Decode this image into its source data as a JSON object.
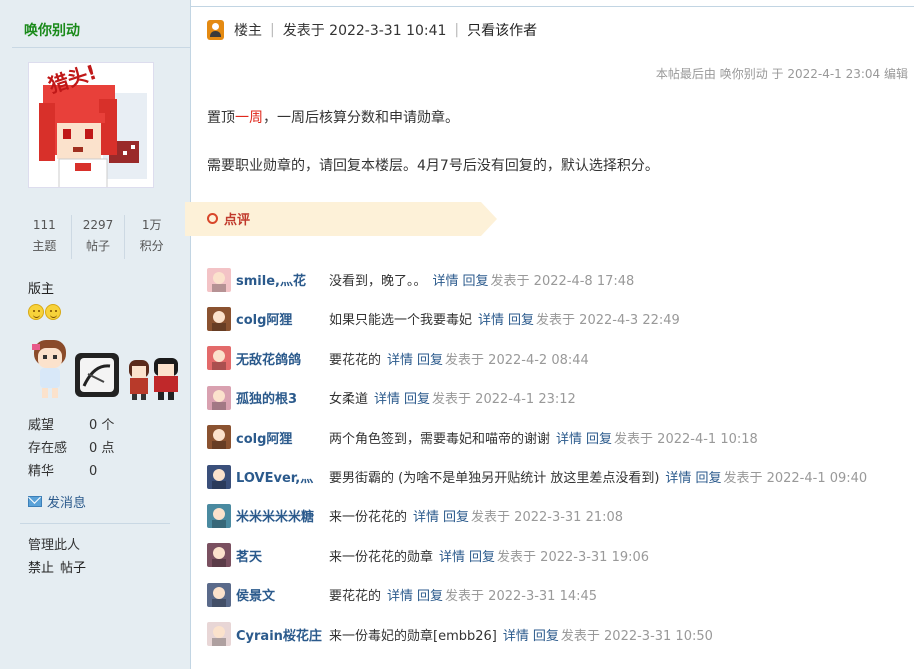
{
  "sidebar": {
    "username": "唤你别动",
    "stats": [
      {
        "num": "111",
        "label": "主题"
      },
      {
        "num": "2297",
        "label": "帖子"
      },
      {
        "num": "1万",
        "label": "积分"
      }
    ],
    "group": "版主",
    "info": [
      {
        "k": "威望",
        "v": "0 个"
      },
      {
        "k": "存在感",
        "v": "0 点"
      },
      {
        "k": "精华",
        "v": "0"
      }
    ],
    "send_message": "发消息",
    "manage_title": "管理此人",
    "manage_ban": "禁止",
    "manage_posts": "帖子",
    "avatar_stamp": "猎头!"
  },
  "post": {
    "floor": "楼主",
    "posted_at": "发表于 2022-3-31 10:41",
    "author_only": "只看该作者",
    "edited_note": "本帖最后由 唤你别动 于 2022-4-1 23:04 编辑",
    "line1_pre": "置顶",
    "line1_red": "一周",
    "line1_post": "，一周后核算分数和申请勋章。",
    "line2": "需要职业勋章的，请回复本楼层。4月7号后没有回复的，默认选择积分。"
  },
  "dianping": {
    "label": "点评"
  },
  "comment_links": {
    "detail": "详情",
    "reply": "回复"
  },
  "comments": [
    {
      "name": "smile,灬花",
      "text": "没看到，晚了。。",
      "time": "发表于 2022-4-8 17:48",
      "color": "#f3c3c6"
    },
    {
      "name": "colg阿狸",
      "text": "如果只能选一个我要毒妃",
      "time": "发表于 2022-4-3 22:49",
      "color": "#8a5230"
    },
    {
      "name": "无敌花鸽鸽",
      "text": "要花花的",
      "time": "发表于 2022-4-2 08:44",
      "color": "#e36a6a"
    },
    {
      "name": "孤独的根3",
      "text": "女柔道",
      "time": "发表于 2022-4-1 23:12",
      "color": "#d9a1b0"
    },
    {
      "name": "colg阿狸",
      "text": "两个角色签到，需要毒妃和喵帝的谢谢",
      "time": "发表于 2022-4-1 10:18",
      "color": "#8a5230"
    },
    {
      "name": "LOVEver,灬",
      "text": "要男街霸的   (为啥不是单独另开贴统计 放这里差点没看到)",
      "time": "发表于 2022-4-1 09:40",
      "color": "#3a4f7a"
    },
    {
      "name": "米米米米米糖",
      "text": "来一份花花的",
      "time": "发表于 2022-3-31 21:08",
      "color": "#4a8aa0"
    },
    {
      "name": "茗天",
      "text": "来一份花花的勋章",
      "time": "发表于 2022-3-31 19:06",
      "color": "#7a5060"
    },
    {
      "name": "侯景文",
      "text": "要花花的",
      "time": "发表于 2022-3-31 14:45",
      "color": "#5a6a8a"
    },
    {
      "name": "Cyrain桜花庄",
      "text": "来一份毒妃的勋章[embb26]",
      "time": "发表于 2022-3-31 10:50",
      "color": "#e8d6d6"
    }
  ]
}
